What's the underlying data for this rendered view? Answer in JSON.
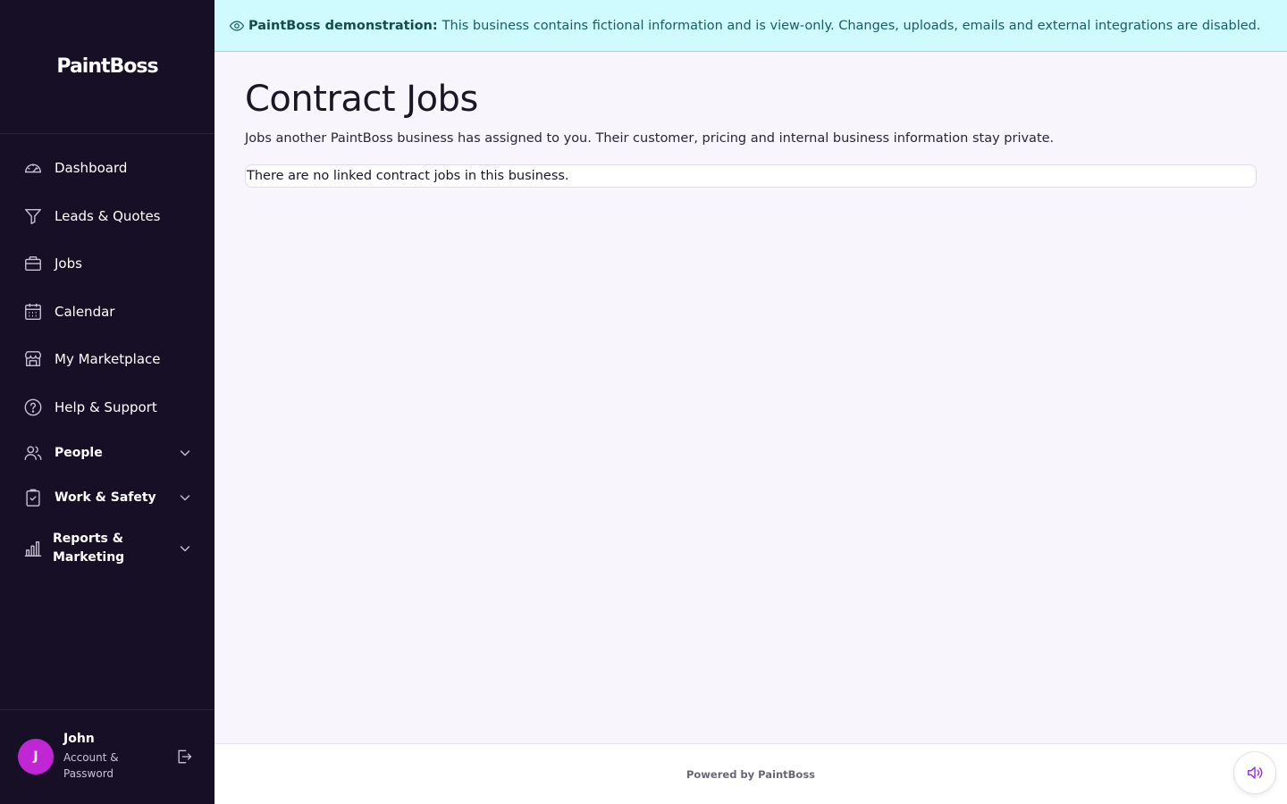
{
  "brand": {
    "name": "PaintBoss"
  },
  "banner": {
    "bold_text": "PaintBoss demonstration:",
    "text": "This business contains fictional information and is view-only. Changes, uploads, emails and external integrations are disabled."
  },
  "sidebar": {
    "items": [
      {
        "label": "Dashboard",
        "icon": "gauge-icon"
      },
      {
        "label": "Leads & Quotes",
        "icon": "funnel-icon"
      },
      {
        "label": "Jobs",
        "icon": "briefcase-icon"
      },
      {
        "label": "Calendar",
        "icon": "calendar-icon"
      },
      {
        "label": "My Marketplace",
        "icon": "storefront-icon"
      },
      {
        "label": "Help & Support",
        "icon": "help-circle-icon"
      }
    ],
    "groups": [
      {
        "label": "People",
        "icon": "people-icon"
      },
      {
        "label": "Work & Safety",
        "icon": "clipboard-check-icon"
      },
      {
        "label_line1": "Reports &",
        "label_line2": "Marketing",
        "icon": "bar-chart-icon"
      }
    ]
  },
  "user": {
    "initial": "J",
    "name": "John",
    "sub_line1": "Account &",
    "sub_line2": "Password"
  },
  "main": {
    "title": "Contract Jobs",
    "subtitle": "Jobs another PaintBoss business has assigned to you. Their customer, pricing and internal business information stay private.",
    "empty_message": "There are no linked contract jobs in this business."
  },
  "footer": {
    "powered_by": "Powered by PaintBoss"
  },
  "colors": {
    "sidebar_bg": "#170f26",
    "banner_bg": "#cffafe",
    "banner_text": "#155e63",
    "avatar": "#c026d3",
    "page_bg": "#f8f5fd",
    "sound_icon": "#9333ea"
  }
}
